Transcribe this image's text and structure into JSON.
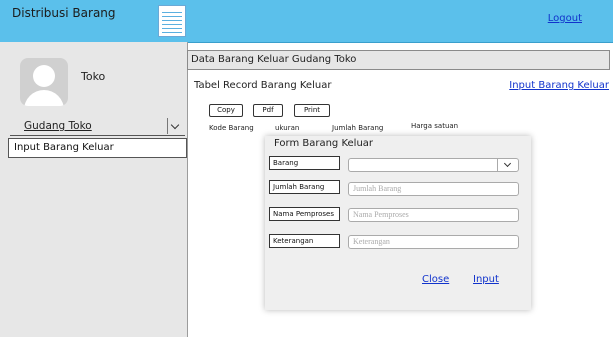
{
  "header": {
    "app_title": "Distribusi Barang",
    "logout_label": "Logout",
    "accent_color": "#5bc0eb",
    "menu_icon": "hamburger-icon"
  },
  "sidebar": {
    "avatar_icon": "user-avatar-icon",
    "role_label": "Toko",
    "dropdown_value": "Gudang Toko",
    "menu_item_label": "Input Barang Keluar"
  },
  "main": {
    "header_title": "Data Barang Keluar Gudang Toko",
    "table_title": "Tabel Record Barang Keluar",
    "input_link": "Input Barang Keluar",
    "export_buttons": [
      "Copy",
      "Pdf",
      "Print"
    ],
    "columns": [
      "Kode Barang",
      "ukuran",
      "Jumlah Barang",
      "Harga satuan"
    ]
  },
  "modal": {
    "title": "Form Barang Keluar",
    "fields": [
      {
        "label": "Barang",
        "value": "",
        "placeholder": ""
      },
      {
        "label": "Jumlah Barang",
        "value": "",
        "placeholder": "Jumlah Barang"
      },
      {
        "label": "Nama Pemproses",
        "value": "",
        "placeholder": "Nama Pemproses"
      },
      {
        "label": "Keterangan",
        "value": "",
        "placeholder": "Keterangan"
      }
    ],
    "close_label": "Close",
    "input_label": "Input"
  }
}
